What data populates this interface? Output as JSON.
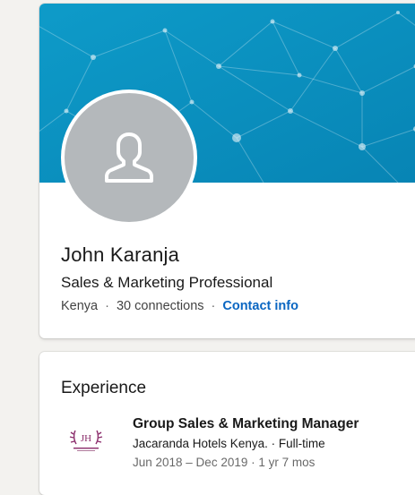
{
  "profile": {
    "name": "John Karanja",
    "headline": "Sales & Marketing Professional",
    "location": "Kenya",
    "separator": "·",
    "connections": "30 connections",
    "contact_label": "Contact info"
  },
  "experience": {
    "section_title": "Experience",
    "items": [
      {
        "logo_text": "JH",
        "title": "Group Sales & Marketing Manager",
        "company": "Jacaranda Hotels Kenya. · Full-time",
        "dates": "Jun 2018 – Dec 2019 · 1 yr 7 mos"
      }
    ]
  },
  "colors": {
    "banner": "#0b8fbf",
    "accent_link": "#0a66c2",
    "avatar_placeholder": "#b4b8bb",
    "logo_purple": "#8a2b6a"
  },
  "icons": {
    "avatar": "person-placeholder-icon",
    "banner": "network-pattern",
    "logo": "jacaranda-hotels-logo"
  }
}
